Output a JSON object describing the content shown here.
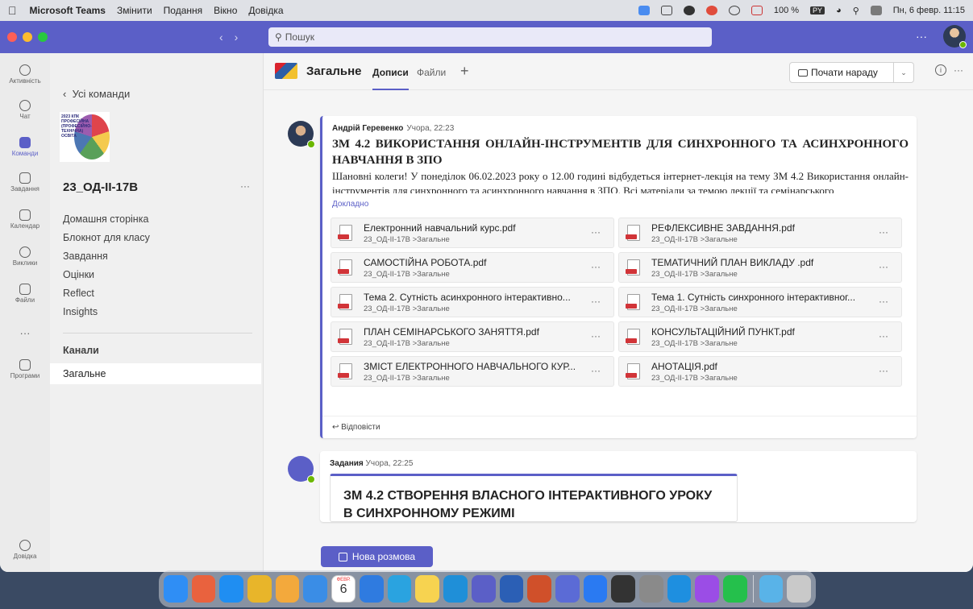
{
  "menubar": {
    "app_name": "Microsoft Teams",
    "items": [
      "Змінити",
      "Подання",
      "Вікно",
      "Довідка"
    ],
    "battery": "100 %",
    "keyboard": "PY",
    "clock": "Пн, 6 февр. 11:15"
  },
  "titlebar": {
    "search_placeholder": "Пошук",
    "more": "···"
  },
  "rail": [
    {
      "label": "Активність",
      "icon": "bell-icon"
    },
    {
      "label": "Чат",
      "icon": "chat-icon"
    },
    {
      "label": "Команди",
      "icon": "teams-icon"
    },
    {
      "label": "Завдання",
      "icon": "assignments-icon"
    },
    {
      "label": "Календар",
      "icon": "calendar-icon"
    },
    {
      "label": "Виклики",
      "icon": "phone-icon"
    },
    {
      "label": "Файли",
      "icon": "file-icon"
    },
    {
      "label": "···",
      "icon": "more-icon"
    },
    {
      "label": "Програми",
      "icon": "apps-icon"
    },
    {
      "label": "Довідка",
      "icon": "help-icon"
    }
  ],
  "teampanel": {
    "back_label": "Усі команди",
    "logo_text": "2023 КПК ПРОФЕСІЙНА (ПРОФЕСІЙНО-ТЕХНІЧНА) ОСВІТА",
    "team_name": "23_ОД-ІІ-17В",
    "team_more": "···",
    "links": [
      "Домашня сторінка",
      "Блокнот для класу",
      "Завдання",
      "Оцінки",
      "Reflect",
      "Insights"
    ],
    "channels_heading": "Канали",
    "channel": "Загальне"
  },
  "channel_header": {
    "title": "Загальне",
    "tabs": [
      "Дописи",
      "Файли"
    ],
    "meet_label": "Почати нараду",
    "dropdown": "⌄",
    "more": "···"
  },
  "post1": {
    "author": "Андрій Геревенко",
    "time": "Учора, 22:23",
    "subject": "ЗМ 4.2 ВИКОРИСТАННЯ ОНЛАЙН-ІНСТРУМЕНТІВ ДЛЯ СИНХРОННОГО ТА АСИНХРОННОГО НАВЧАННЯ В ЗПО",
    "body": "Шановні колеги! У понеділок 06.02.2023 року о 12.00 годині відбудеться інтернет-лекція на тему  ЗМ 4.2 Використання онлайн-інструментів для синхронного та асинхронного навчання в ЗПО. Всі матеріали за темою лекції та семінарського",
    "more_link": "Докладно",
    "reply_label": "Відповісти",
    "attachments": [
      {
        "name": "Електронний навчальний курс.pdf",
        "path": "23_ОД-ІІ-17В >Загальне"
      },
      {
        "name": "РЕФЛЕКСИВНЕ ЗАВДАННЯ.pdf",
        "path": "23_ОД-ІІ-17В >Загальне"
      },
      {
        "name": "САМОСТІЙНА РОБОТА.pdf",
        "path": "23_ОД-ІІ-17В >Загальне"
      },
      {
        "name": "ТЕМАТИЧНИЙ ПЛАН ВИКЛАДУ .pdf",
        "path": "23_ОД-ІІ-17В >Загальне"
      },
      {
        "name": "Тема 2. Сутність асинхронного інтерактивно...",
        "path": "23_ОД-ІІ-17В >Загальне"
      },
      {
        "name": "Тема 1. Сутність синхронного інтерактивног...",
        "path": "23_ОД-ІІ-17В >Загальне"
      },
      {
        "name": "ПЛАН СЕМІНАРСЬКОГО ЗАНЯТТЯ.pdf",
        "path": "23_ОД-ІІ-17В >Загальне"
      },
      {
        "name": "КОНСУЛЬТАЦІЙНИЙ ПУНКТ.pdf",
        "path": "23_ОД-ІІ-17В >Загальне"
      },
      {
        "name": "ЗМІСТ ЕЛЕКТРОННОГО НАВЧАЛЬНОГО КУР...",
        "path": "23_ОД-ІІ-17В >Загальне"
      },
      {
        "name": "АНОТАЦІЯ.pdf",
        "path": "23_ОД-ІІ-17В >Загальне"
      }
    ],
    "attachment_more": "···"
  },
  "post2": {
    "author": "Задания",
    "time": "Учора, 22:25",
    "card_title": "ЗМ 4.2 СТВОРЕННЯ ВЛАСНОГО ІНТЕРАКТИВНОГО УРОКУ В СИНХРОННОМУ РЕЖИМІ"
  },
  "new_conversation": "Нова розмова",
  "dock": {
    "calendar_month": "ФЕВР.",
    "calendar_day": "6",
    "icons": [
      "finder-icon",
      "launchpad-icon",
      "safari-icon",
      "chrome-icon",
      "photos-icon",
      "mail-icon",
      "calendar-icon",
      "browser-icon",
      "telegram-icon",
      "notes-icon",
      "vpn-icon",
      "teams-icon",
      "word-icon",
      "powerpoint-icon",
      "pencil-icon",
      "app-store-icon",
      "calculator-icon",
      "settings-icon",
      "skype-icon",
      "messenger-icon",
      "whatsapp-icon",
      "folder-icon",
      "trash-icon"
    ],
    "colors": [
      "#2f8ef5",
      "#e9623e",
      "#1f8ef2",
      "#e8b52a",
      "#f3a93c",
      "#3a8de6",
      "#ffffff",
      "#2f7be0",
      "#2aa3e0",
      "#f7d350",
      "#1f8fd8",
      "#5b5fc7",
      "#2b5fb5",
      "#d0502a",
      "#5b6bd6",
      "#2a7af2",
      "#333333",
      "#8a8a8a",
      "#1e8fe0",
      "#9b4de6",
      "#25c04c",
      "#59b3e8",
      "#c9c9c9"
    ]
  }
}
